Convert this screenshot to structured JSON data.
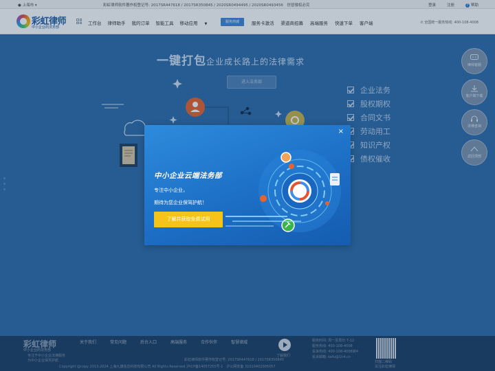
{
  "topbar": {
    "location": "上海市",
    "registration": "彩虹律师软件著作权登记号: 2017SR447618 / 2017SR350845 / 2020SR0494495 / 2020SR0493456　仿冒侵权必究",
    "login": "登录",
    "register": "注册",
    "help": "帮助"
  },
  "nav": {
    "logo_name": "彩虹律师",
    "logo_sub": "中小企业的法务部",
    "links": [
      "工作台",
      "律师助手",
      "我的订单",
      "智能工具",
      "移动应用"
    ],
    "active_button": "服务商城",
    "links_right": [
      "服务卡激活",
      "渠道商招募",
      "高端服务",
      "快速下单",
      "客户端"
    ],
    "hotline": "全国统一服务热线: 400-108-4008"
  },
  "hero": {
    "headline_big": "一键打包",
    "headline_small": "企业成长路上的法律需求",
    "enter_button": "进入法务部",
    "checklist": [
      "企业法务",
      "股权期权",
      "合同文书",
      "劳动用工",
      "知识产权",
      "债权催收"
    ]
  },
  "side_buttons": [
    {
      "label": "律师客服",
      "icon": "chat-icon"
    },
    {
      "label": "客户端下载",
      "icon": "download-icon"
    },
    {
      "label": "法律咨询",
      "icon": "headset-icon"
    },
    {
      "label": "返回顶部",
      "icon": "chevron-up-icon"
    }
  ],
  "modal": {
    "close": "×",
    "title": "中小企业云端法务部",
    "line1": "专注中小企业，",
    "line2": "期待为您企业保驾护航！",
    "cta": "了解并获取免费试用"
  },
  "footer": {
    "logo_name": "彩虹律师",
    "logo_sub": "中小企业的法务部",
    "desc1": "专注于中小企业法律服务",
    "desc2": "为中小企业保驾护航",
    "links": [
      "关于我们",
      "常见问题",
      "后台入口",
      "高端服务",
      "合作伙伴",
      "智慧律威"
    ],
    "play_label": "了解我们",
    "contact": [
      "服务时间: 周一至周日 7-12",
      "服务热线: 400-108-4008",
      "投诉热线: 400-108-4008转4",
      "投诉邮箱: kefu@1h4.cn"
    ],
    "qr_label1": "扫描二维码",
    "qr_label2": "关注彩虹律师",
    "registration": "彩虹律师软件著作权登记号: 2017SR447618 / 2017SR350845",
    "copyright": "Copyright @copy 2013-2024 上海九旗信息科技有限公司 All Rights Reserved 沪ICP备14057255号-1　沪公网安备 31010402005057"
  },
  "colors": {
    "brand_blue": "#1f5fa8",
    "hero_bg": "#2d6ca9",
    "modal_bg": "#1c6fc5",
    "cta_yellow": "#f5c31a",
    "footer_bg": "#1d3f64"
  }
}
